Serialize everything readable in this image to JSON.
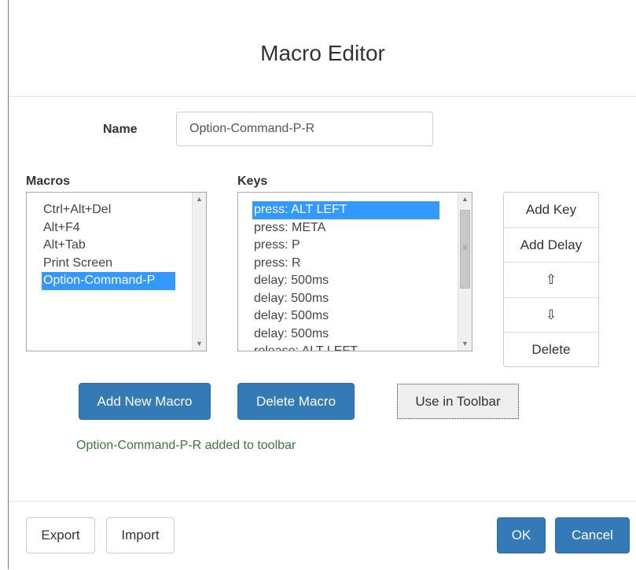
{
  "dialog": {
    "title": "Macro Editor"
  },
  "name": {
    "label": "Name",
    "value": "Option-Command-P-R"
  },
  "macros": {
    "label": "Macros",
    "items": [
      "Ctrl+Alt+Del",
      "Alt+F4",
      "Alt+Tab",
      "Print Screen",
      "Option-Command-P"
    ],
    "selected": "Option-Command-P"
  },
  "keys": {
    "label": "Keys",
    "items": [
      "press: ALT LEFT",
      "press: META",
      "press: P",
      "press: R",
      "delay: 500ms",
      "delay: 500ms",
      "delay: 500ms",
      "delay: 500ms",
      "release: ALT LEFT"
    ],
    "selected": "press: ALT LEFT"
  },
  "key_actions": {
    "add_key": "Add Key",
    "add_delay": "Add Delay",
    "move_up": "⇧",
    "move_down": "⇩",
    "delete": "Delete"
  },
  "actions": {
    "add_macro": "Add New Macro",
    "delete_macro": "Delete Macro",
    "use_toolbar": "Use in Toolbar"
  },
  "status": "Option-Command-P-R added to toolbar",
  "footer": {
    "export": "Export",
    "import": "Import",
    "ok": "OK",
    "cancel": "Cancel"
  },
  "colors": {
    "primary": "#337ab7",
    "selection": "#3399ff",
    "success_text": "#3c763d"
  }
}
